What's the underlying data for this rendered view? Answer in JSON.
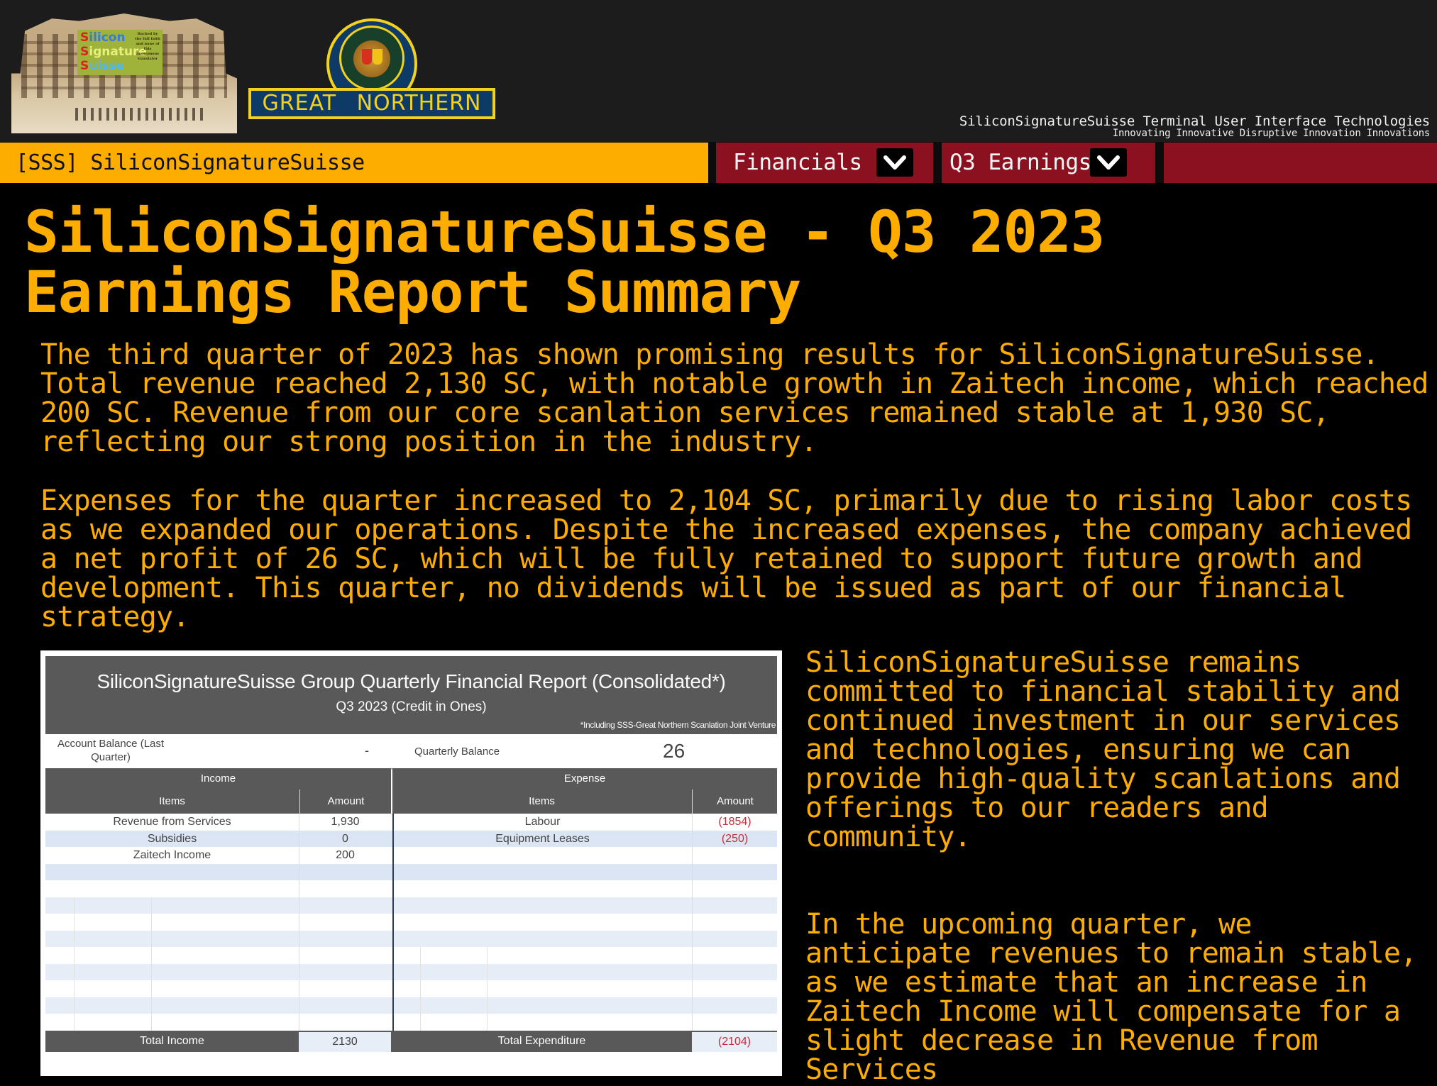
{
  "header": {
    "logo_primary": {
      "alt": "SiliconSignatureSuisse building logo",
      "sign_words": [
        "ilicon",
        "ignature",
        "uisse"
      ],
      "sign_initial": "S",
      "sign_small_text": "Backed by the full faith and none of this anonymous translator"
    },
    "logo_secondary": {
      "alt": "Great Northern Railway logo",
      "plate_text": "GREAT NORTHERN"
    },
    "tagline": "SiliconSignatureSuisse Terminal User Interface Technologies",
    "subtagline": "Innovating Innovative Disruptive Innovation Innovations"
  },
  "nav": {
    "home_label": "[SSS] SiliconSignatureSuisse",
    "tabs": [
      {
        "label": "Financials",
        "icon": "chevron-down-icon"
      },
      {
        "label": "Q3 Earnings",
        "icon": "chevron-down-icon"
      }
    ],
    "colors": {
      "home": "#fdac00",
      "tab": "#8b1020"
    }
  },
  "article": {
    "title": "SiliconSignatureSuisse - Q3 2023 Earnings Report Summary",
    "paragraphs": [
      "The third quarter of 2023 has shown promising results for SiliconSignatureSuisse. Total revenue reached 2,130 SC, with notable growth in Zaitech income, which reached 200 SC. Revenue from our core scanlation services remained stable at 1,930 SC, reflecting our strong position in the industry.",
      "Expenses for the quarter increased to 2,104 SC, primarily due to rising labor costs as we expanded our operations. Despite the increased expenses, the company achieved a net profit of 26 SC, which will be fully retained to support future growth and development. This quarter, no dividends will be issued as part of our financial strategy."
    ],
    "side_paragraphs": [
      "SiliconSignatureSuisse remains committed to financial stability and continued investment in our services and technologies, ensuring we can provide high-quality scanlations and offerings to our readers and community.",
      "In the upcoming quarter, we anticipate revenues to remain stable, as we estimate that an increase in Zaitech Income will compensate for a slight decrease in Revenue from Services"
    ],
    "accent_color": "#fdac00"
  },
  "report": {
    "title": "SiliconSignatureSuisse Group Quarterly Financial Report (Consolidated*)",
    "subtitle": "Q3 2023 (Credit in Ones)",
    "footnote": "*Including SSS-Great Northern Scanlation Joint Venture",
    "account_balance_label": "Account Balance (Last Quarter)",
    "account_balance_value": "-",
    "quarterly_balance_label": "Quarterly Balance",
    "quarterly_balance_value": "26",
    "income": {
      "caption": "Income",
      "col_items": "Items",
      "col_amount": "Amount",
      "rows": [
        {
          "item": "Revenue from Services",
          "amount": "1,930"
        },
        {
          "item": "Subsidies",
          "amount": "0"
        },
        {
          "item": "Zaitech Income",
          "amount": "200"
        }
      ],
      "total_label": "Total Income",
      "total_value": "2130"
    },
    "expense": {
      "caption": "Expense",
      "col_items": "Items",
      "col_amount": "Amount",
      "rows": [
        {
          "item": "Labour",
          "amount": "(1854)"
        },
        {
          "item": "Equipment Leases",
          "amount": "(250)"
        }
      ],
      "total_label": "Total Expenditure",
      "total_value": "(2104)"
    },
    "negative_color": "#c0303a"
  }
}
